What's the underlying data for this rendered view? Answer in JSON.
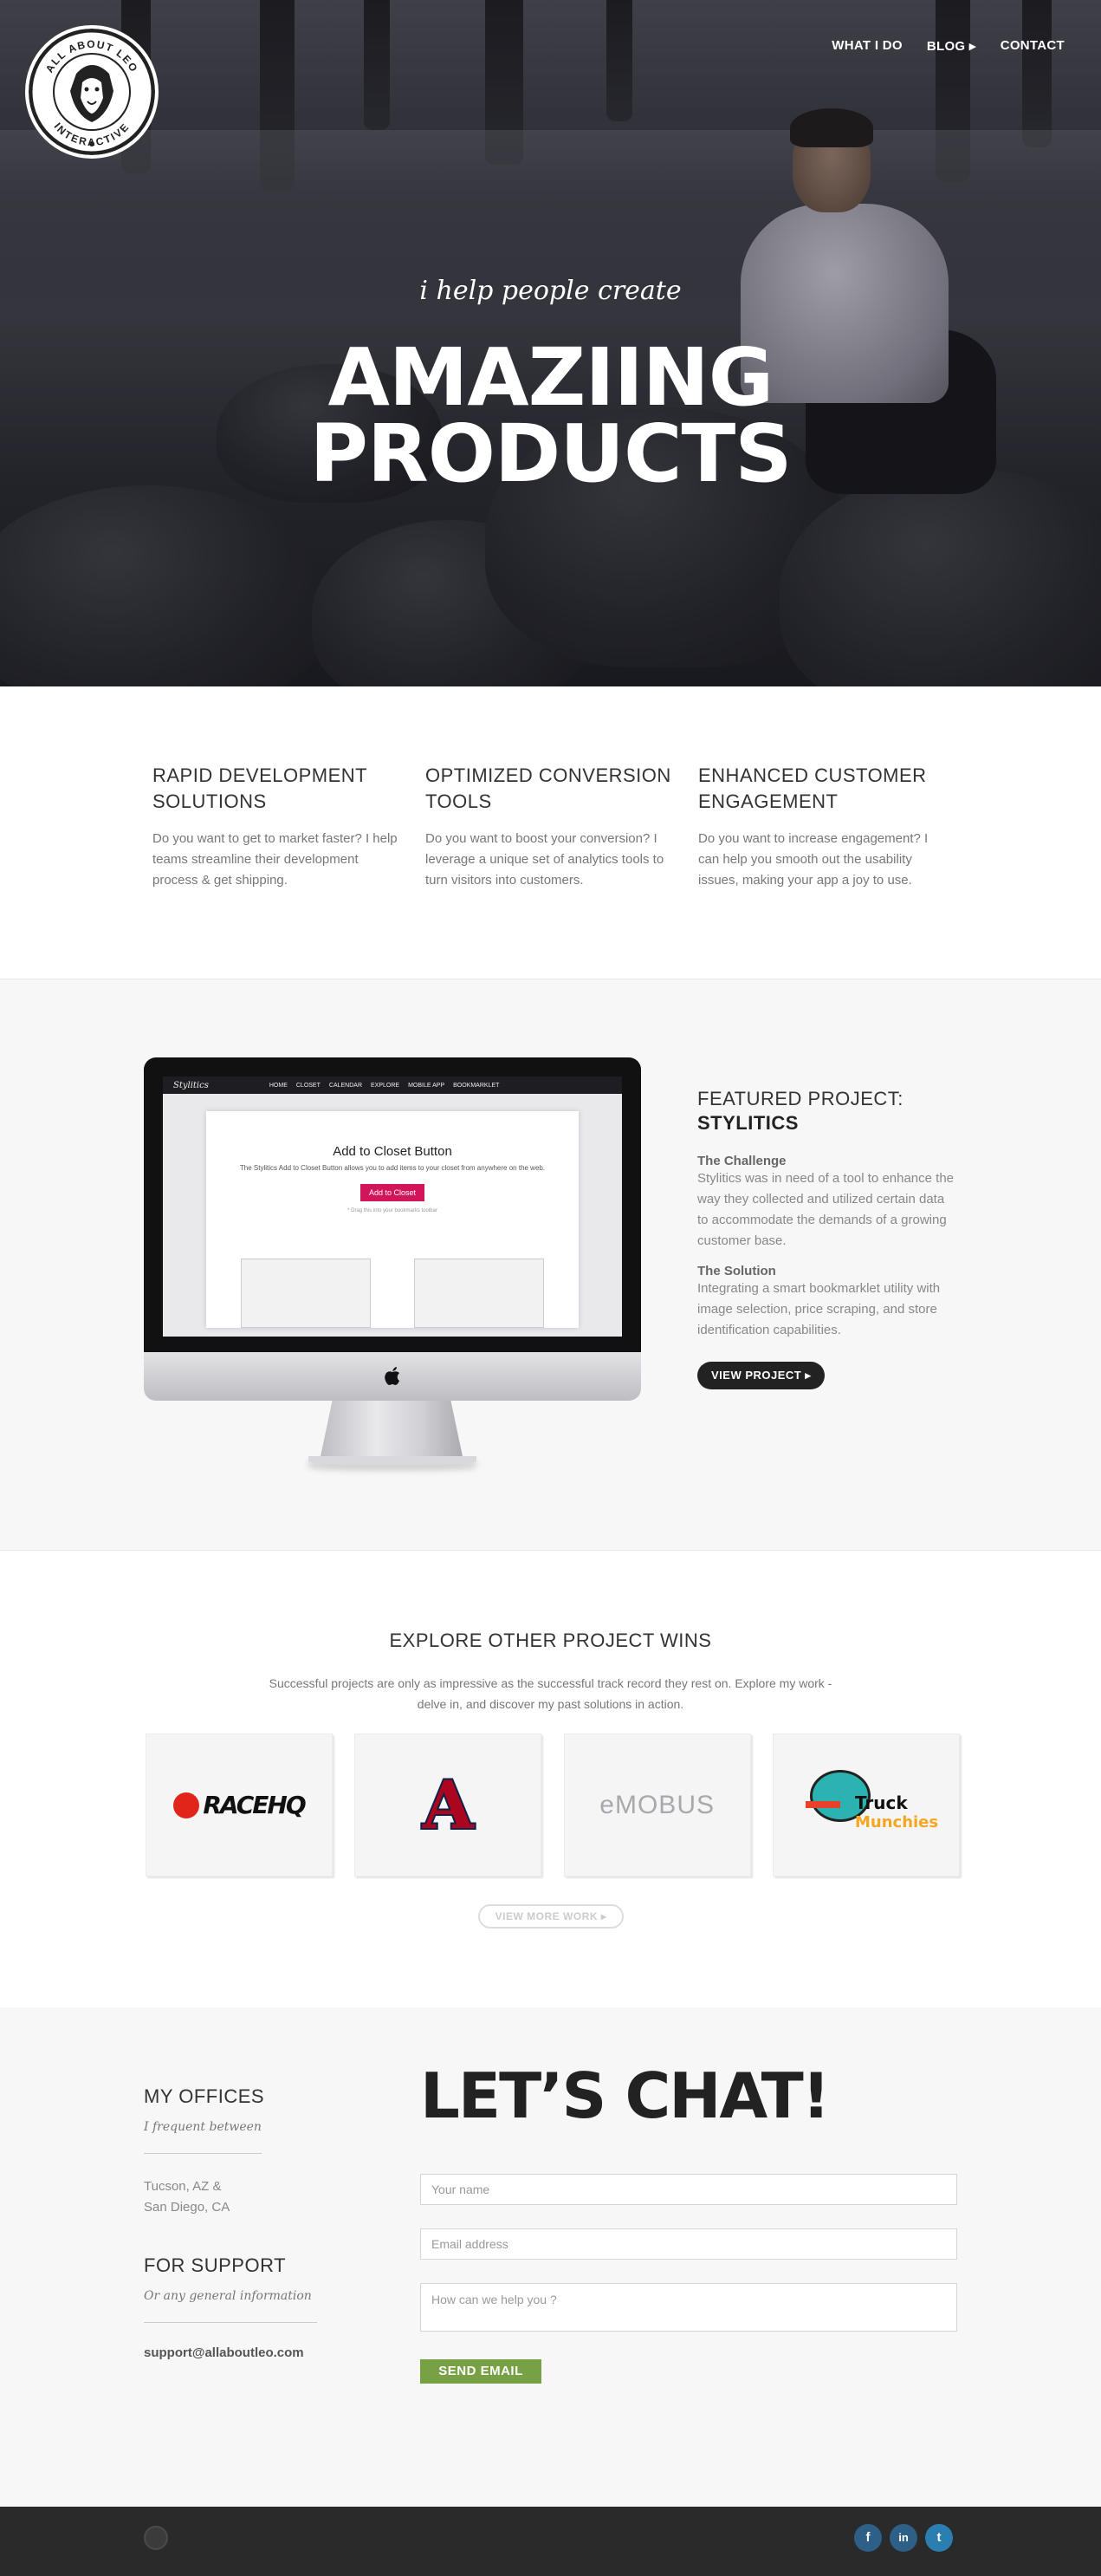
{
  "logo": {
    "top_text": "ALL ABOUT LEO",
    "bottom_text": "INTERACTIVE"
  },
  "nav": {
    "items": [
      {
        "label": "WHAT I DO"
      },
      {
        "label": "BLOG ▸"
      },
      {
        "label": "CONTACT"
      }
    ]
  },
  "hero": {
    "tagline": "i help people create",
    "headline_line1": "AMAZIING",
    "headline_line2": "PRODUCTS"
  },
  "services": [
    {
      "title_line1": "RAPID DEVELOPMENT",
      "title_line2": "SOLUTIONS",
      "text": "Do you want to get to market faster? I help teams streamline their development process & get shipping."
    },
    {
      "title_line1": "OPTIMIZED CONVERSION",
      "title_line2": "TOOLS",
      "text": "Do you want to boost your conversion? I leverage a unique set of analytics tools to turn visitors into customers."
    },
    {
      "title_line1": "ENHANCED CUSTOMER",
      "title_line2": "ENGAGEMENT",
      "text": "Do you want to increase engagement? I can help you smooth out the usability issues, making your app a joy to use."
    }
  ],
  "featured": {
    "kicker": "FEATURED PROJECT:",
    "name": "STYLITICS",
    "challenge_title": "The Challenge",
    "challenge_text": "Stylitics was in need of a tool to enhance the way they collected and utilized certain data to accommodate the demands of a growing customer base.",
    "solution_title": "The Solution",
    "solution_text": "Integrating a smart bookmarklet utility with image selection, price scraping, and store identification capabilities.",
    "button": "VIEW PROJECT ▸",
    "screen": {
      "brand": "Stylitics",
      "menu": [
        "HOME",
        "CLOSET",
        "CALENDAR",
        "EXPLORE",
        "MOBILE APP",
        "BOOKMARKLET"
      ],
      "card_title": "Add to Closet Button",
      "card_desc": "The Stylitics Add to Closet Button allows you to add items to your closet from anywhere on the web.",
      "card_button": "Add to Closet",
      "card_hint": "* Drag this into your bookmarks toolbar"
    }
  },
  "wins": {
    "title": "EXPLORE OTHER PROJECT WINS",
    "description": "Successful projects are only as impressive as the successful track record they rest on. Explore my work - delve in, and discover my past solutions in action.",
    "items": [
      {
        "logo_text": "RACEHQ"
      },
      {
        "logo_text": "A"
      },
      {
        "logo_text": "eMOBUS"
      },
      {
        "logo_text": "Truck",
        "logo_sub": "Munchies"
      }
    ],
    "button": "VIEW MORE WORK ▸"
  },
  "contact": {
    "offices_title": "MY OFFICES",
    "offices_italic": "I frequent between",
    "address_line1": "Tucson, AZ &",
    "address_line2": "San Diego, CA",
    "support_title": "FOR SUPPORT",
    "support_italic": "Or any general information",
    "support_email": "support@allaboutleo.com",
    "chat_title": "LET’S CHAT!",
    "name_placeholder": "Your name",
    "email_placeholder": "Email address",
    "message_placeholder": "How can we help you ?",
    "send_button": "SEND EMAIL"
  },
  "footer": {
    "social": [
      "f",
      "in",
      "t"
    ]
  },
  "colors": {
    "accent_green": "#77a144",
    "dark": "#222222",
    "social_blue": "#2e5f86",
    "stylitics_pink": "#d0155a"
  }
}
